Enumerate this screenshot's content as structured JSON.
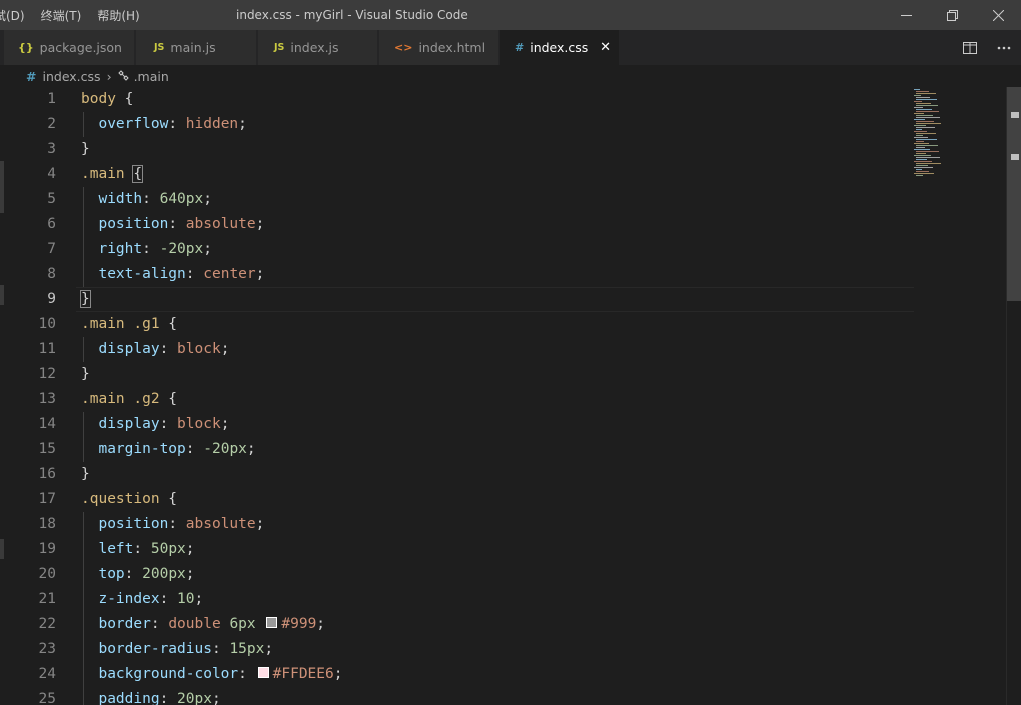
{
  "titlebar": {
    "menu": [
      "试(D)",
      "终端(T)",
      "帮助(H)"
    ],
    "title": "index.css - myGirl - Visual Studio Code"
  },
  "tabs": [
    {
      "label": "package.json",
      "icon": "{}",
      "icon_color": "#cbcb41"
    },
    {
      "label": "main.js",
      "icon": "JS",
      "icon_color": "#cbcb41"
    },
    {
      "label": "index.js",
      "icon": "JS",
      "icon_color": "#cbcb41"
    },
    {
      "label": "index.html",
      "icon": "<>",
      "icon_color": "#e37933"
    },
    {
      "label": "index.css",
      "icon": "#",
      "icon_color": "#519aba",
      "active": true
    }
  ],
  "breadcrumb": {
    "file": "index.css",
    "symbol": ".main"
  },
  "editor": {
    "current_line": 9,
    "lines": [
      {
        "n": "1",
        "tokens": [
          [
            "sel",
            "body"
          ],
          [
            "punc",
            " {"
          ]
        ]
      },
      {
        "n": "2",
        "tokens": [
          [
            "prop",
            "overflow"
          ],
          [
            "punc",
            ": "
          ],
          [
            "val",
            "hidden"
          ],
          [
            "punc",
            ";"
          ]
        ],
        "indent": true
      },
      {
        "n": "3",
        "tokens": [
          [
            "punc",
            "}"
          ]
        ]
      },
      {
        "n": "4",
        "tokens": [
          [
            "sel",
            ".main"
          ],
          [
            "punc",
            " "
          ],
          [
            "bracket",
            "{"
          ]
        ]
      },
      {
        "n": "5",
        "tokens": [
          [
            "prop",
            "width"
          ],
          [
            "punc",
            ": "
          ],
          [
            "num",
            "640px"
          ],
          [
            "punc",
            ";"
          ]
        ],
        "indent": true
      },
      {
        "n": "6",
        "tokens": [
          [
            "prop",
            "position"
          ],
          [
            "punc",
            ": "
          ],
          [
            "val",
            "absolute"
          ],
          [
            "punc",
            ";"
          ]
        ],
        "indent": true
      },
      {
        "n": "7",
        "tokens": [
          [
            "prop",
            "right"
          ],
          [
            "punc",
            ": "
          ],
          [
            "num",
            "-20px"
          ],
          [
            "punc",
            ";"
          ]
        ],
        "indent": true
      },
      {
        "n": "8",
        "tokens": [
          [
            "prop",
            "text-align"
          ],
          [
            "punc",
            ": "
          ],
          [
            "val",
            "center"
          ],
          [
            "punc",
            ";"
          ]
        ],
        "indent": true
      },
      {
        "n": "9",
        "tokens": [
          [
            "bracket",
            "}"
          ]
        ]
      },
      {
        "n": "10",
        "tokens": [
          [
            "sel",
            ".main .g1"
          ],
          [
            "punc",
            " {"
          ]
        ]
      },
      {
        "n": "11",
        "tokens": [
          [
            "prop",
            "display"
          ],
          [
            "punc",
            ": "
          ],
          [
            "val",
            "block"
          ],
          [
            "punc",
            ";"
          ]
        ],
        "indent": true
      },
      {
        "n": "12",
        "tokens": [
          [
            "punc",
            "}"
          ]
        ]
      },
      {
        "n": "13",
        "tokens": [
          [
            "sel",
            ".main .g2"
          ],
          [
            "punc",
            " {"
          ]
        ]
      },
      {
        "n": "14",
        "tokens": [
          [
            "prop",
            "display"
          ],
          [
            "punc",
            ": "
          ],
          [
            "val",
            "block"
          ],
          [
            "punc",
            ";"
          ]
        ],
        "indent": true
      },
      {
        "n": "15",
        "tokens": [
          [
            "prop",
            "margin-top"
          ],
          [
            "punc",
            ": "
          ],
          [
            "num",
            "-20px"
          ],
          [
            "punc",
            ";"
          ]
        ],
        "indent": true
      },
      {
        "n": "16",
        "tokens": [
          [
            "punc",
            "}"
          ]
        ]
      },
      {
        "n": "17",
        "tokens": [
          [
            "sel",
            ".question"
          ],
          [
            "punc",
            " {"
          ]
        ]
      },
      {
        "n": "18",
        "tokens": [
          [
            "prop",
            "position"
          ],
          [
            "punc",
            ": "
          ],
          [
            "val",
            "absolute"
          ],
          [
            "punc",
            ";"
          ]
        ],
        "indent": true
      },
      {
        "n": "19",
        "tokens": [
          [
            "prop",
            "left"
          ],
          [
            "punc",
            ": "
          ],
          [
            "num",
            "50px"
          ],
          [
            "punc",
            ";"
          ]
        ],
        "indent": true
      },
      {
        "n": "20",
        "tokens": [
          [
            "prop",
            "top"
          ],
          [
            "punc",
            ": "
          ],
          [
            "num",
            "200px"
          ],
          [
            "punc",
            ";"
          ]
        ],
        "indent": true
      },
      {
        "n": "21",
        "tokens": [
          [
            "prop",
            "z-index"
          ],
          [
            "punc",
            ": "
          ],
          [
            "num",
            "10"
          ],
          [
            "punc",
            ";"
          ]
        ],
        "indent": true
      },
      {
        "n": "22",
        "tokens": [
          [
            "prop",
            "border"
          ],
          [
            "punc",
            ": "
          ],
          [
            "val",
            "double "
          ],
          [
            "num",
            "6px"
          ],
          [
            "punc",
            " "
          ],
          [
            "swatch",
            "#999999"
          ],
          [
            "val",
            "#999"
          ],
          [
            "punc",
            ";"
          ]
        ],
        "indent": true
      },
      {
        "n": "23",
        "tokens": [
          [
            "prop",
            "border-radius"
          ],
          [
            "punc",
            ": "
          ],
          [
            "num",
            "15px"
          ],
          [
            "punc",
            ";"
          ]
        ],
        "indent": true
      },
      {
        "n": "24",
        "tokens": [
          [
            "prop",
            "background-color"
          ],
          [
            "punc",
            ": "
          ],
          [
            "swatch",
            "#FFDEE6"
          ],
          [
            "val",
            "#FFDEE6"
          ],
          [
            "punc",
            ";"
          ]
        ],
        "indent": true
      },
      {
        "n": "25",
        "tokens": [
          [
            "prop",
            "padding"
          ],
          [
            "punc",
            ": "
          ],
          [
            "num",
            "20px"
          ],
          [
            "punc",
            ";"
          ]
        ],
        "indent": true
      }
    ]
  },
  "colors": {
    "editor_bg": "#1e1e1e",
    "titlebar_bg": "#3c3c3c",
    "tab_inactive_bg": "#2d2d2d",
    "selector": "#d7ba7d",
    "property": "#9cdcfe",
    "value": "#ce9178",
    "number": "#b5cea8"
  }
}
